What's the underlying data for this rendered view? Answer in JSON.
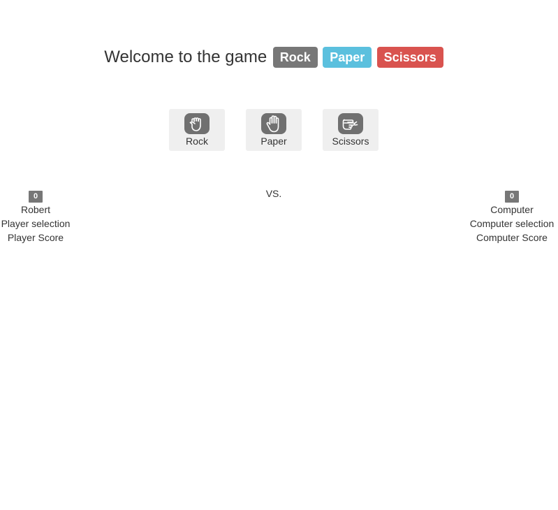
{
  "theme": {
    "rock_color": "#777777",
    "paper_color": "#5bc0de",
    "scissors_color": "#d9534f"
  },
  "heading": {
    "title": "Welcome to the game",
    "labels": {
      "rock": "Rock",
      "paper": "Paper",
      "scissors": "Scissors"
    }
  },
  "choices": [
    {
      "label": "Rock",
      "icon": "rock-hand-icon"
    },
    {
      "label": "Paper",
      "icon": "paper-hand-icon"
    },
    {
      "label": "Scissors",
      "icon": "scissors-hand-icon"
    }
  ],
  "player": {
    "score": "0",
    "name": "Robert",
    "selection_label": "Player selection",
    "score_label": "Player Score"
  },
  "vs_text": "VS.",
  "computer": {
    "score": "0",
    "name": "Computer",
    "selection_label": "Computer selection",
    "score_label": "Computer Score"
  }
}
